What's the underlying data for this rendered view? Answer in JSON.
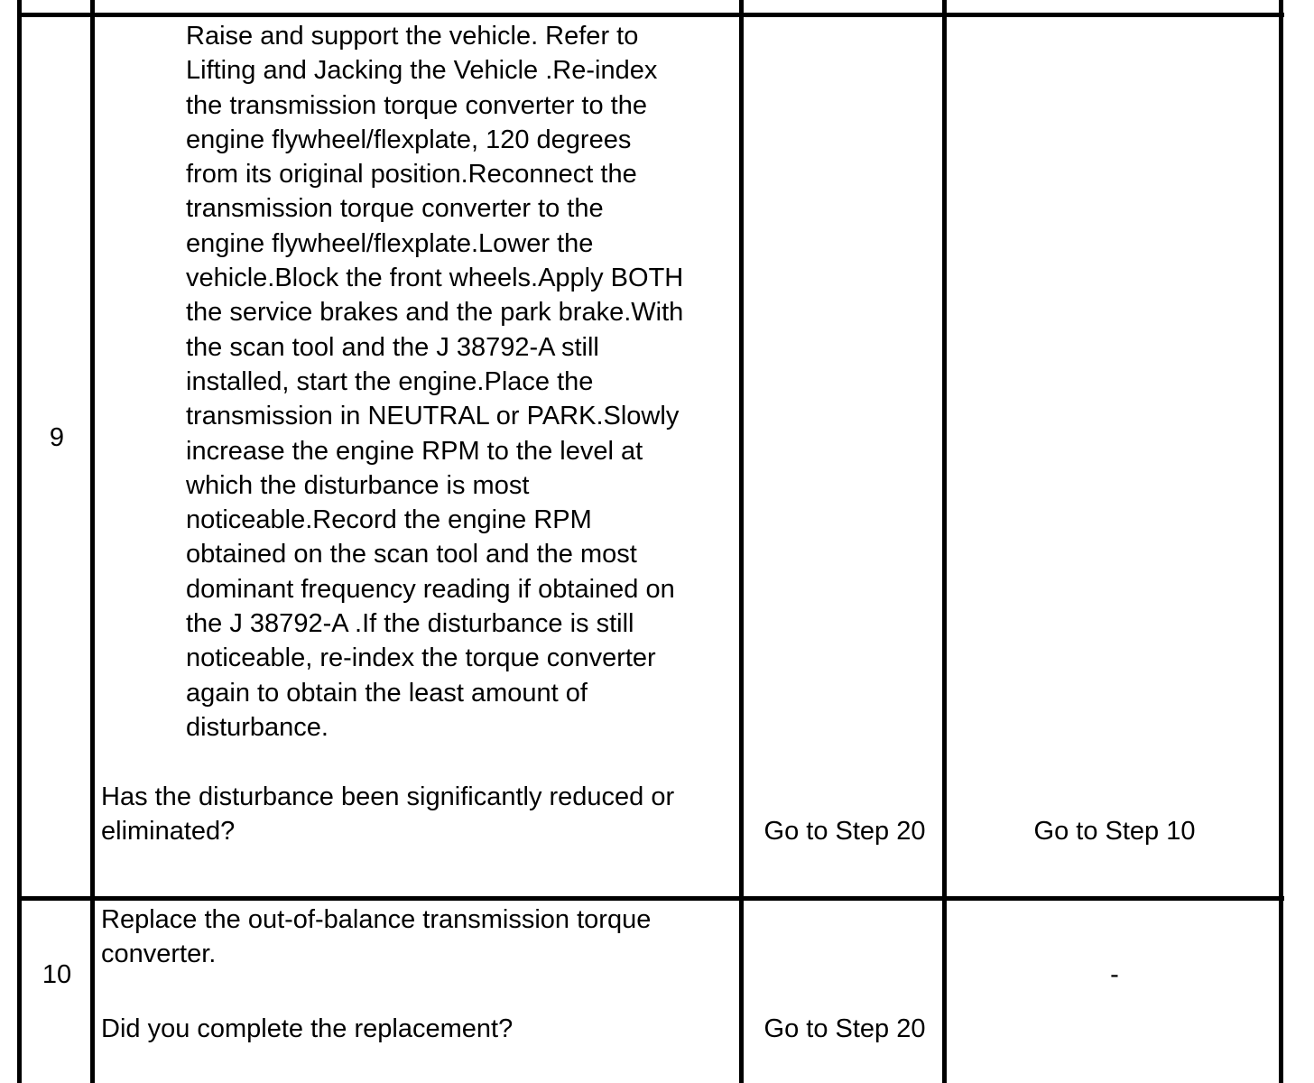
{
  "rows": [
    {
      "step": "9",
      "instruction": "Raise and support the vehicle. Refer to\nLifting and Jacking the Vehicle .Re-index\nthe transmission torque converter to the\nengine flywheel/flexplate, 120 degrees\nfrom its original position.Reconnect the\ntransmission torque converter to the\nengine flywheel/flexplate.Lower the\nvehicle.Block the front wheels.Apply BOTH\nthe service brakes and the park brake.With\nthe scan tool and the J 38792-A still\ninstalled, start the engine.Place the\ntransmission in NEUTRAL or PARK.Slowly\nincrease the engine RPM to the level at\nwhich the disturbance is most\nnoticeable.Record the engine RPM\nobtained on the scan tool and the most\ndominant frequency reading if obtained on\nthe J 38792-A .If the disturbance is still\nnoticeable, re-index the torque converter\nagain to obtain the least amount of\ndisturbance.",
      "question": "Has the disturbance been significantly reduced or\neliminated?",
      "yes": "Go to Step 20",
      "no": "Go to Step 10"
    },
    {
      "step": "10",
      "instruction": "Replace the out-of-balance transmission torque\nconverter.",
      "question": "Did you complete the replacement?",
      "yes": "Go to Step 20",
      "no": "-"
    }
  ]
}
